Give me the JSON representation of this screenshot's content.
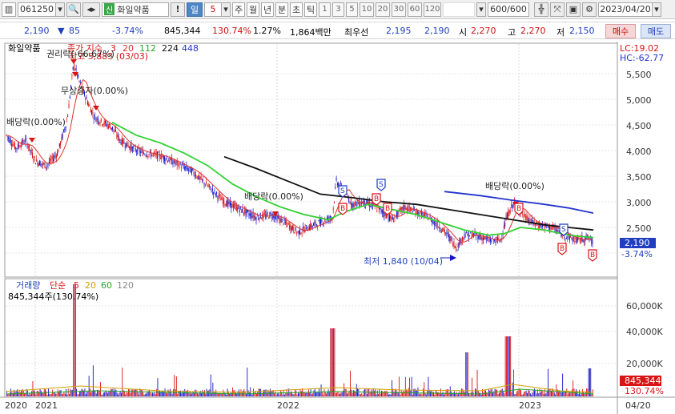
{
  "toolbar": {
    "code": "061250",
    "stock_name": "화일약품",
    "name_badge": "신",
    "period_selected": "일",
    "period_value": "5",
    "periods": [
      "주",
      "월",
      "년",
      "분",
      "초",
      "틱"
    ],
    "intervals": [
      "1",
      "3",
      "5",
      "10",
      "20",
      "30",
      "60",
      "120"
    ],
    "count": "600/600",
    "date": "2023/04/20",
    "exclaim": "!"
  },
  "quote": {
    "price": "2,190",
    "change": "85",
    "change_pct": "-3.74%",
    "volume": "845,344",
    "volume_pct": "130.74%",
    "turnover": "1.27%",
    "amount": "1,864백만",
    "best_sell_label": "최우선",
    "best_sell": "2,195",
    "best_buy": "2,190",
    "open_label": "시",
    "open": "2,270",
    "high_label": "고",
    "high": "2,270",
    "low_label": "저",
    "low": "2,150",
    "buy_label": "매수",
    "sell_label": "매도"
  },
  "price_panel": {
    "legend_name": "화일약품",
    "legend_ma_label": "종가 지수",
    "ma_periods": [
      "3",
      "20",
      "112",
      "224",
      "448"
    ],
    "lc": "LC:19.02",
    "hc": "HC:-62.77",
    "y_ticks": [
      "5,500",
      "5,000",
      "4,500",
      "4,000",
      "3,500",
      "3,000",
      "2,500"
    ],
    "current_price_tag": "2,190",
    "current_change_tag": "-3.74%",
    "annotations": {
      "high": "최고 5,883 (03/03)",
      "rights": "권리락(-66.67%)",
      "bonus": "무상증자(0.00%)",
      "div1": "배당락(0.00%)",
      "div2": "배당락(0.00%)",
      "div3": "배당락(0.00%)",
      "low": "최저 1,840 (10/04)"
    },
    "signals": {
      "S": "S",
      "B": "B"
    }
  },
  "volume_panel": {
    "legend_name": "거래량",
    "legend_ma_label": "단순",
    "ma_periods": [
      "5",
      "20",
      "60",
      "120"
    ],
    "value_label": "845,344주(130.74%)",
    "y_ticks": [
      "60,000K",
      "40,000K",
      "20,000K"
    ],
    "current_tag": "845,344",
    "current_pct_tag": "130.74%"
  },
  "x_axis": {
    "labels": [
      "2020",
      "2021",
      "2022",
      "2023",
      "04/20"
    ]
  },
  "colors": {
    "up": "#d81414",
    "down": "#1414c8",
    "ma3": "#d81414",
    "ma20": "#e03030",
    "ma112": "#32d232",
    "ma224": "#111111",
    "ma448": "#2233cc"
  }
}
